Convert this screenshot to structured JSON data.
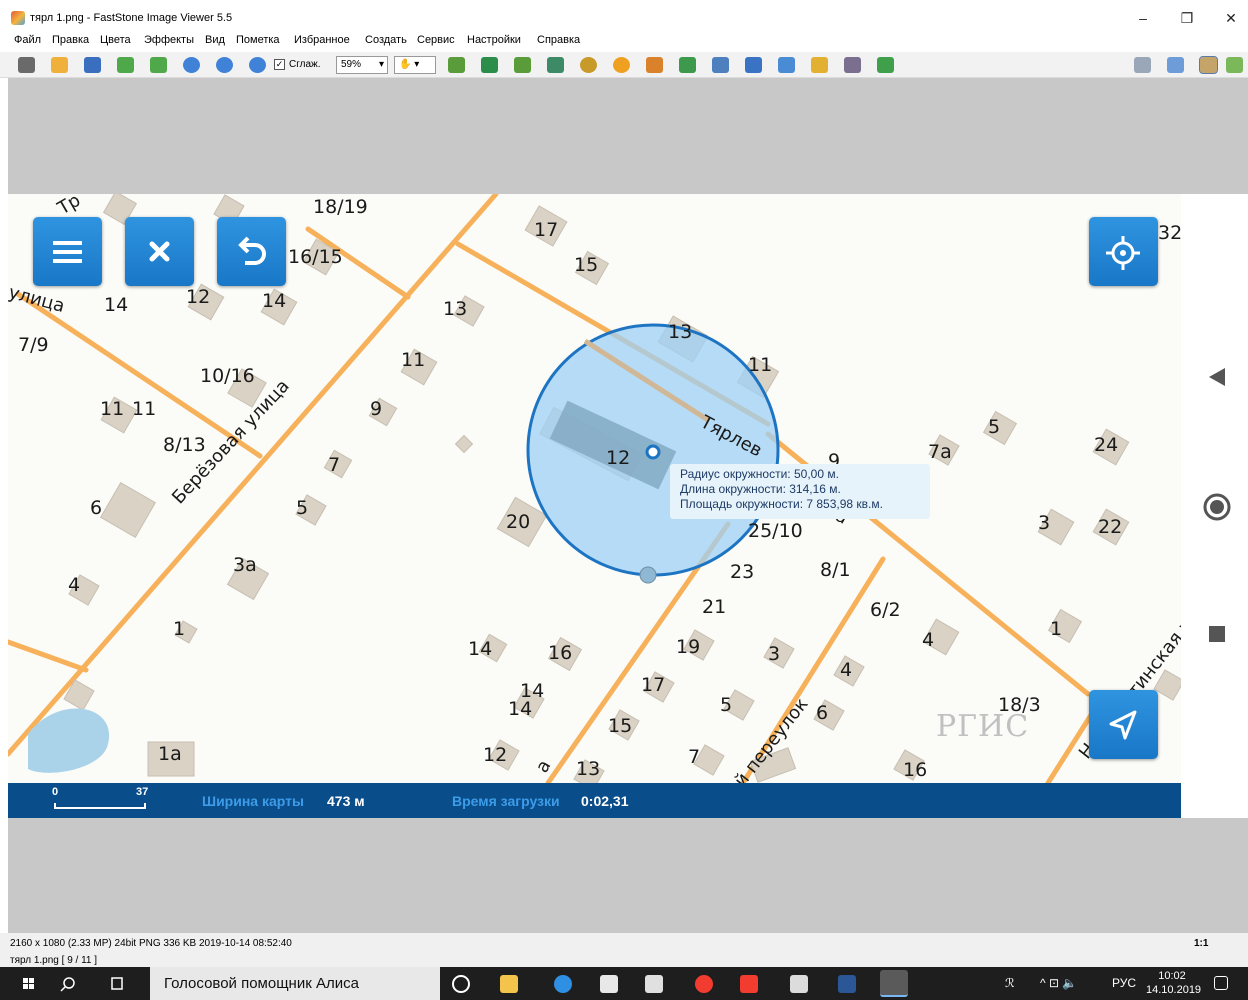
{
  "window": {
    "title": "тярл 1.png  -  FastStone Image Viewer 5.5",
    "minimize": "–",
    "restore": "❐",
    "close": "✕"
  },
  "menu": [
    "Файл",
    "Правка",
    "Цвета",
    "Эффекты",
    "Вид",
    "Пометка",
    "Избранное",
    "Создать",
    "Сервис",
    "Настройки",
    "Справка"
  ],
  "toolbar": {
    "smooth_label": "Сглаж.",
    "smooth_checked": "✓",
    "zoom_value": "59%",
    "zoom_arrow": "▾",
    "hand_label": "✋ ▾"
  },
  "map": {
    "street_names": {
      "berezovaya": "Берёзовая улица",
      "ulitsa_left": "улица",
      "tyarlev": "Тярлев",
      "pereulok": "й переулок",
      "novo": "Новолестинская ул",
      "cha": "ча",
      "a_letter": "а",
      "tr": "Тр"
    },
    "house_numbers": {
      "h1819": "18/19",
      "h1615": "16/15",
      "h17a": "17",
      "h15a": "15",
      "h14a": "14",
      "h12a": "12",
      "h14b": "14",
      "h13a": "13",
      "h79": "7/9",
      "h11a": "11",
      "h1016": "10/16",
      "h13b": "13",
      "h11b": "11",
      "h11c": "11",
      "h11d": "11",
      "h9a": "9",
      "h813": "8/13",
      "h7a": "7",
      "h7b": "7а",
      "h5a": "5",
      "h24": "24",
      "h6a": "6",
      "h5b": "5",
      "h20": "20",
      "h12b": "12",
      "h9b": "9",
      "h3a": "3",
      "h22": "22",
      "h2510": "25/10",
      "h3b": "3а",
      "h4a": "4",
      "h23": "23",
      "h81": "8/1",
      "h21": "21",
      "h62": "6/2",
      "h1a": "1",
      "h4b": "4",
      "h1b": "1",
      "h14c": "14",
      "h16a": "16",
      "h19": "19",
      "h3c": "3",
      "h4c": "4",
      "h17b": "17",
      "h14d": "14",
      "h14e": "14",
      "h5c": "5",
      "h6b": "6",
      "h183": "18/3",
      "h15b": "15",
      "h1c": "1а",
      "h12c": "12",
      "h7c": "7",
      "h13c": "13",
      "h16b": "16",
      "h32": "32"
    },
    "circle_info": {
      "radius": "Радиус окружности: 50,00 м.",
      "length": "Длина окружности: 314,16 м.",
      "area": "Площадь окружности: 7 853,98 кв.м."
    },
    "watermark": "РГИС",
    "scale_start": "0",
    "scale_end": "37",
    "width_label": "Ширина карты",
    "width_value": "473 м",
    "load_label": "Время загрузки",
    "load_value": "0:02,31"
  },
  "status": {
    "info": "2160 x 1080 (2.33 MP)  24bit  PNG   336 KB   2019-10-14 08:52:40",
    "file": "тярл 1.png [ 9 / 11 ]",
    "zoom_ratio": "1:1"
  },
  "taskbar": {
    "search_text": "Голосовой помощник Алиса",
    "tray_user": "ℛ",
    "tray_arrows": "^ ⊡ 🔈",
    "lang": "РУС",
    "time": "10:02",
    "date": "14.10.2019"
  },
  "colors": {
    "accent_blue": "#1d86d6",
    "statusbar_blue": "#0a4d8b",
    "road_orange": "#f6b15a",
    "building": "#d9d2c5",
    "circle_fill": "#9dd0f5"
  }
}
